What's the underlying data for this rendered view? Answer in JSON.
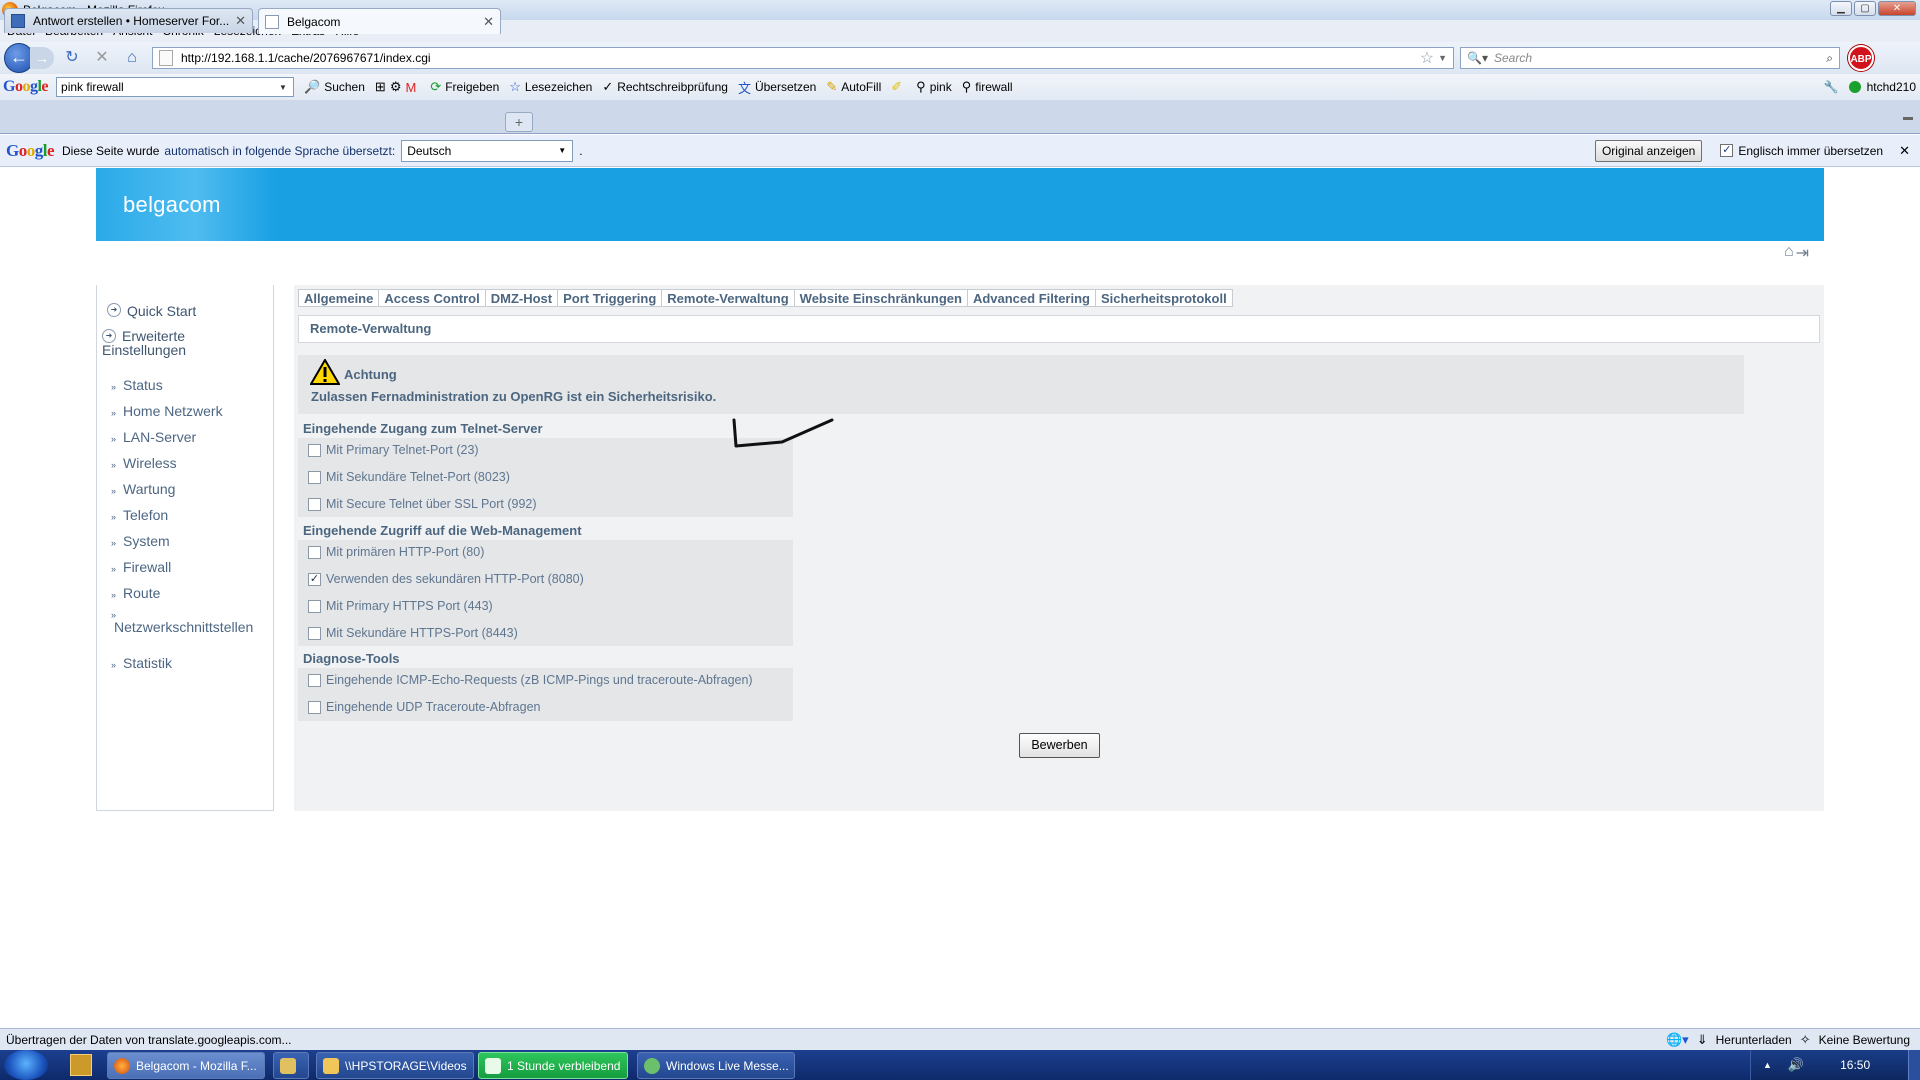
{
  "window": {
    "title": "Belgacom - Mozilla Firefox"
  },
  "menubar": [
    "Datei",
    "Bearbeiten",
    "Ansicht",
    "Chronik",
    "Lesezeichen",
    "Extras",
    "Hilfe"
  ],
  "navbar": {
    "url": "http://192.168.1.1/cache/2076967671/index.cgi",
    "search_placeholder": "Search",
    "abp_label": "ABP"
  },
  "google_toolbar": {
    "logo": "Google",
    "search_value": "pink firewall",
    "items": [
      "Suchen",
      "Freigeben",
      "Lesezeichen",
      "Rechtschreibprüfung",
      "Übersetzen",
      "AutoFill",
      "pink",
      "firewall"
    ],
    "user": "htchd210"
  },
  "tabs": [
    {
      "label": "Antwort erstellen • Homeserver For..."
    },
    {
      "label": "Belgacom"
    }
  ],
  "translate_bar": {
    "logo": "Google",
    "text1": "Diese Seite wurde",
    "text2": "automatisch in folgende Sprache übersetzt:",
    "language": "Deutsch",
    "dot": ".",
    "original_button": "Original anzeigen",
    "always_label": "Englisch immer übersetzen"
  },
  "banner": {
    "logo_text": "belgacom"
  },
  "sidebar": {
    "main": [
      {
        "label": "Quick Start"
      },
      {
        "label": "Erweiterte Einstellungen"
      }
    ],
    "sub": [
      "Status",
      "Home Netzwerk",
      "LAN-Server",
      "Wireless",
      "Wartung",
      "Telefon",
      "System",
      "Firewall",
      "Route",
      "Netzwerkschnittstellen",
      "Statistik"
    ]
  },
  "main": {
    "tabs": [
      "Allgemeine",
      "Access Control",
      "DMZ-Host",
      "Port Triggering",
      "Remote-Verwaltung",
      "Website Einschränkungen",
      "Advanced Filtering",
      "Sicherheitsprotokoll"
    ],
    "page_title": "Remote-Verwaltung",
    "warning_title": "Achtung",
    "warning_text": "Zulassen Fernadministration zu OpenRG ist ein Sicherheitsrisiko.",
    "sections": [
      {
        "title": "Eingehende Zugang zum Telnet-Server",
        "options": [
          {
            "label": "Mit Primary Telnet-Port (23)",
            "checked": false
          },
          {
            "label": "Mit Sekundäre Telnet-Port (8023)",
            "checked": false
          },
          {
            "label": "Mit Secure Telnet über SSL Port (992)",
            "checked": false
          }
        ]
      },
      {
        "title": "Eingehende Zugriff auf die Web-Management",
        "options": [
          {
            "label": "Mit primären HTTP-Port (80)",
            "checked": false
          },
          {
            "label": "Verwenden des sekundären HTTP-Port (8080)",
            "checked": true
          },
          {
            "label": "Mit Primary HTTPS Port (443)",
            "checked": false
          },
          {
            "label": "Mit Sekundäre HTTPS-Port (8443)",
            "checked": false
          }
        ]
      },
      {
        "title": "Diagnose-Tools",
        "options": [
          {
            "label": "Eingehende ICMP-Echo-Requests (zB ICMP-Pings und traceroute-Abfragen)",
            "checked": false
          },
          {
            "label": "Eingehende UDP Traceroute-Abfragen",
            "checked": false
          }
        ]
      }
    ],
    "apply_button": "Bewerben"
  },
  "statusbar": {
    "text": "Übertragen der Daten von translate.googleapis.com...",
    "download": "Herunterladen",
    "rating": "Keine Bewertung"
  },
  "taskbar": {
    "buttons": [
      "Belgacom - Mozilla F...",
      "\\\\HPSTORAGE\\Videos",
      "1 Stunde verbleibend",
      "Windows Live Messe..."
    ],
    "clock": "16:50"
  },
  "colors": {
    "banner": "#19a0e3",
    "link_text": "#4c6680"
  }
}
